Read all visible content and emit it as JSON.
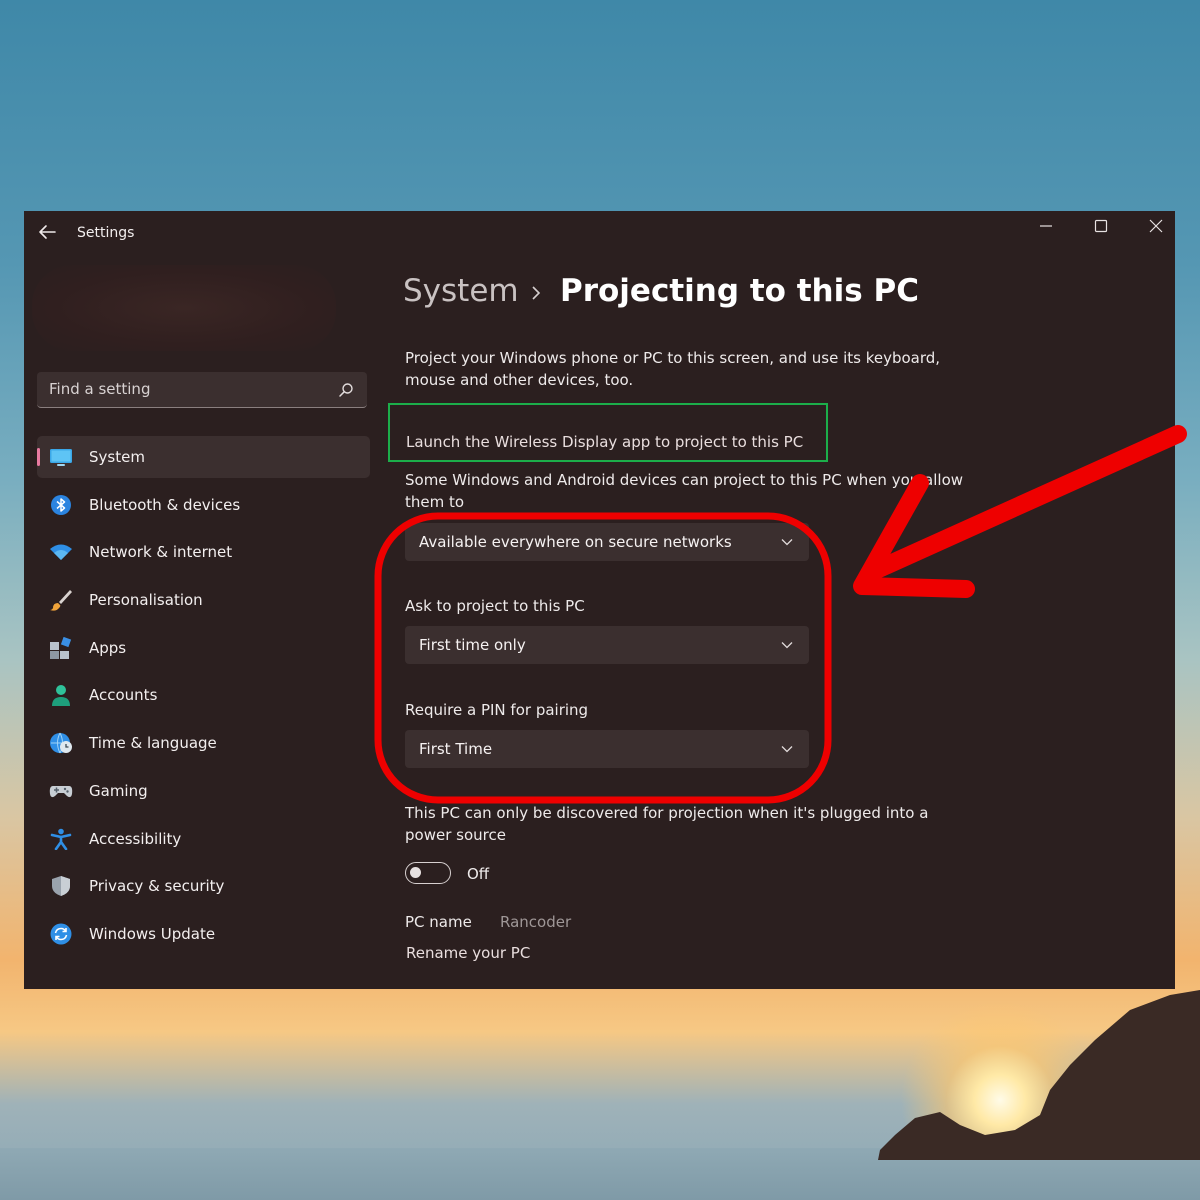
{
  "window": {
    "title": "Settings",
    "controls": [
      "minimize-icon",
      "maximize-icon",
      "close-icon"
    ]
  },
  "search": {
    "placeholder": "Find a setting"
  },
  "sidebar": {
    "items": [
      {
        "label": "System",
        "icon": "monitor-icon",
        "active": true
      },
      {
        "label": "Bluetooth & devices",
        "icon": "bluetooth-icon"
      },
      {
        "label": "Network & internet",
        "icon": "wifi-icon"
      },
      {
        "label": "Personalisation",
        "icon": "brush-icon"
      },
      {
        "label": "Apps",
        "icon": "apps-icon"
      },
      {
        "label": "Accounts",
        "icon": "person-icon"
      },
      {
        "label": "Time & language",
        "icon": "globe-clock-icon"
      },
      {
        "label": "Gaming",
        "icon": "gamepad-icon"
      },
      {
        "label": "Accessibility",
        "icon": "accessibility-icon"
      },
      {
        "label": "Privacy & security",
        "icon": "shield-icon"
      },
      {
        "label": "Windows Update",
        "icon": "update-icon"
      }
    ]
  },
  "header": {
    "parent": "System",
    "current": "Projecting to this PC"
  },
  "main": {
    "intro": "Project your Windows phone or PC to this screen, and use its keyboard, mouse and other devices, too.",
    "launch_link": "Launch the Wireless Display app to project to this PC",
    "availability_text": "Some Windows and Android devices can project to this PC when you allow them to",
    "availability_value": "Available everywhere on secure networks",
    "ask_label": "Ask to project to this PC",
    "ask_value": "First time only",
    "pin_label": "Require a PIN for pairing",
    "pin_value": "First Time",
    "power_text": "This PC can only be discovered for projection when it's plugged into a power source",
    "power_toggle_state": "Off",
    "pc_name_label": "PC name",
    "pc_name_value": "Rancoder",
    "rename_link": "Rename your PC"
  },
  "colors": {
    "window_bg": "#2b1f1f",
    "accent_pink": "#e87aa0",
    "highlight_green": "#1cae4a",
    "annotation_red": "#ee0000"
  }
}
